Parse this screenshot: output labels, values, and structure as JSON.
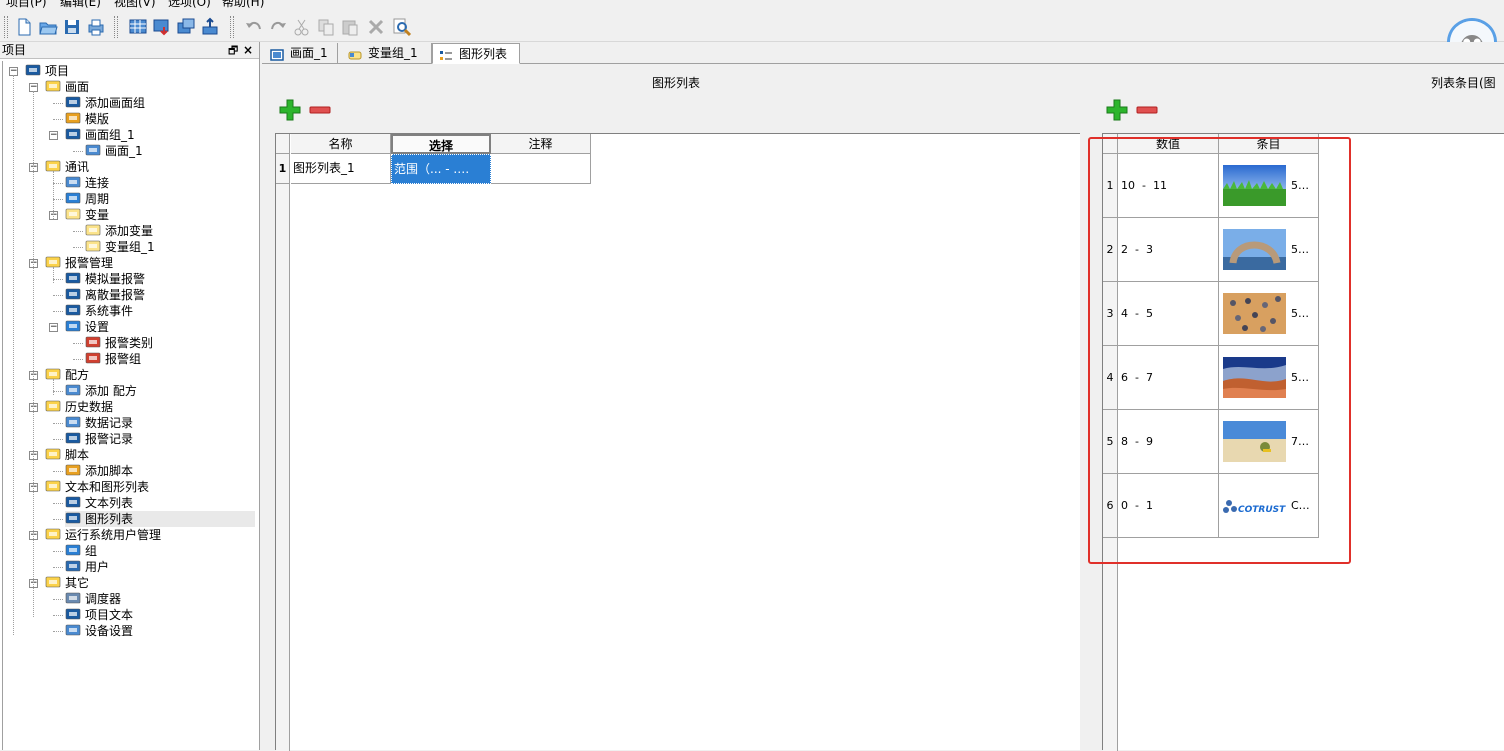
{
  "menubar": {
    "items": [
      {
        "label": "项目(P)"
      },
      {
        "label": "编辑(E)"
      },
      {
        "label": "视图(V)"
      },
      {
        "label": "选项(O)"
      },
      {
        "label": "帮助(H)"
      }
    ]
  },
  "toolbar": {
    "buttons": [
      "new-file-icon",
      "open-folder-icon",
      "save-icon",
      "print-icon",
      "screen-grid-icon",
      "download-screen-icon",
      "transfer-icon",
      "upload-icon",
      "undo-icon",
      "redo-icon",
      "cut-icon",
      "copy-icon",
      "paste-icon",
      "delete-icon",
      "find-icon"
    ]
  },
  "left_panel": {
    "title": "项目",
    "dock_glyph": "🗗",
    "close_glyph": "×",
    "tree": [
      {
        "label": "项目",
        "icon": "factory-icon"
      },
      {
        "label": "画面",
        "icon": "folder-screen-icon"
      },
      {
        "label": "添加画面组",
        "icon": "add-screen-group-icon"
      },
      {
        "label": "模版",
        "icon": "template-icon"
      },
      {
        "label": "画面组_1",
        "icon": "screen-group-icon"
      },
      {
        "label": "画面_1",
        "icon": "screen-icon"
      },
      {
        "label": "通讯",
        "icon": "folder-comm-icon"
      },
      {
        "label": "连接",
        "icon": "connection-icon"
      },
      {
        "label": "周期",
        "icon": "cycle-icon"
      },
      {
        "label": "变量",
        "icon": "variable-icon"
      },
      {
        "label": "添加变量",
        "icon": "add-variable-icon"
      },
      {
        "label": "变量组_1",
        "icon": "variable-group-icon"
      },
      {
        "label": "报警管理",
        "icon": "folder-alarm-icon"
      },
      {
        "label": "模拟量报警",
        "icon": "analog-alarm-icon"
      },
      {
        "label": "离散量报警",
        "icon": "discrete-alarm-icon"
      },
      {
        "label": "系统事件",
        "icon": "system-event-icon"
      },
      {
        "label": "设置",
        "icon": "settings-icon"
      },
      {
        "label": "报警类别",
        "icon": "alarm-class-icon"
      },
      {
        "label": "报警组",
        "icon": "alarm-group-icon"
      },
      {
        "label": "配方",
        "icon": "folder-recipe-icon"
      },
      {
        "label": "添加 配方",
        "icon": "add-recipe-icon"
      },
      {
        "label": "历史数据",
        "icon": "folder-history-icon"
      },
      {
        "label": "数据记录",
        "icon": "data-log-icon"
      },
      {
        "label": "报警记录",
        "icon": "alarm-log-icon"
      },
      {
        "label": "脚本",
        "icon": "folder-script-icon"
      },
      {
        "label": "添加脚本",
        "icon": "add-script-icon"
      },
      {
        "label": "文本和图形列表",
        "icon": "folder-list-icon"
      },
      {
        "label": "文本列表",
        "icon": "text-list-icon"
      },
      {
        "label": "图形列表",
        "icon": "graphic-list-icon"
      },
      {
        "label": "运行系统用户管理",
        "icon": "folder-user-icon"
      },
      {
        "label": "组",
        "icon": "group-icon"
      },
      {
        "label": "用户",
        "icon": "user-icon"
      },
      {
        "label": "其它",
        "icon": "folder-other-icon"
      },
      {
        "label": "调度器",
        "icon": "scheduler-icon"
      },
      {
        "label": "项目文本",
        "icon": "project-text-icon"
      },
      {
        "label": "设备设置",
        "icon": "device-settings-icon"
      }
    ]
  },
  "tabs": [
    {
      "label": "画面_1",
      "icon": "screen-icon",
      "active": false
    },
    {
      "label": "变量组_1",
      "icon": "variable-group-icon",
      "active": false
    },
    {
      "label": "图形列表",
      "icon": "graphic-list-icon",
      "active": true
    }
  ],
  "graphic_list": {
    "title": "图形列表",
    "columns": [
      "名称",
      "选择",
      "注释"
    ],
    "rows": [
      {
        "index": "1",
        "name": "图形列表_1",
        "selection": "范围（... - .…",
        "comment": ""
      }
    ]
  },
  "list_entries": {
    "title": "列表条目(图",
    "columns": [
      "数值",
      "条目"
    ],
    "rows": [
      {
        "index": "1",
        "value": "10  -  11",
        "image": "grass-sky-image",
        "label": "5…"
      },
      {
        "index": "2",
        "value": "2  -  3",
        "image": "stone-arch-image",
        "label": "5…"
      },
      {
        "index": "3",
        "value": "4  -  5",
        "image": "pebbles-sand-image",
        "label": "5…"
      },
      {
        "index": "4",
        "value": "6  -  7",
        "image": "desert-dune-image",
        "label": "5…"
      },
      {
        "index": "5",
        "value": "8  -  9",
        "image": "beach-image",
        "label": "7…"
      },
      {
        "index": "6",
        "value": "0  -  1",
        "image": "cotrust-logo-image",
        "logo_text": "COTRUST",
        "label": "C…"
      }
    ]
  },
  "colors": {
    "selection": "#2a7fd4",
    "highlight_box": "#e0302a",
    "add_green": "#2db52d",
    "remove_red": "#e05050"
  }
}
